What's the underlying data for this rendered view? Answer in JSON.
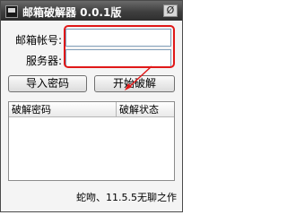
{
  "window": {
    "title": "邮箱破解器 0.0.1版",
    "close_glyph": "Ø"
  },
  "form": {
    "email_label": "邮箱帐号:",
    "email_value": "",
    "server_label": "服务器:",
    "server_value": ""
  },
  "buttons": {
    "import_label": "导入密码",
    "start_label": "开始破解"
  },
  "table": {
    "columns": [
      "破解密码",
      "破解状态"
    ],
    "rows": []
  },
  "footer": {
    "credit": "蛇吻、11.5.5无聊之作"
  },
  "colors": {
    "annotation": "#e01818"
  }
}
